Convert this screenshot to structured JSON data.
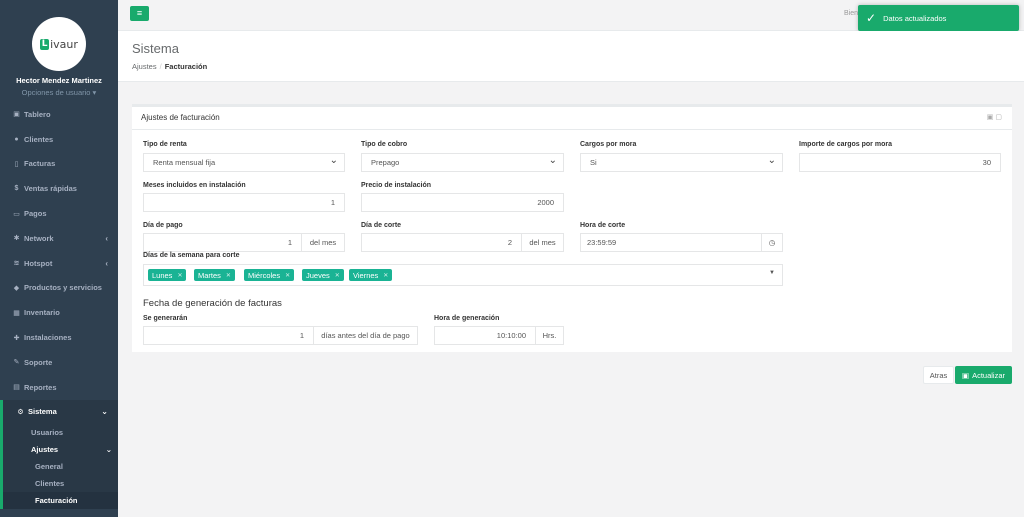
{
  "profile": {
    "logo_text": "ivaur",
    "logo_letter": "L",
    "name": "Hector Mendez Martinez",
    "options": "Opciones de usuario ▾"
  },
  "nav": {
    "tablero": "Tablero",
    "clientes": "Clientes",
    "facturas": "Facturas",
    "ventas": "Ventas rápidas",
    "pagos": "Pagos",
    "network": "Network",
    "hotspot": "Hotspot",
    "productos": "Productos y servicios",
    "inventario": "Inventario",
    "instalaciones": "Instalaciones",
    "soporte": "Soporte",
    "reportes": "Reportes",
    "sistema": "Sistema",
    "usuarios": "Usuarios",
    "ajustes": "Ajustes",
    "general": "General",
    "clientes_sub": "Clientes",
    "facturacion": "Facturación"
  },
  "topbar": {
    "welcome": "Bien"
  },
  "toast": {
    "message": "Datos actualizados"
  },
  "page": {
    "title": "Sistema",
    "breadcrumb": [
      "Ajustes",
      "Facturación"
    ]
  },
  "card": {
    "title": "Ajustes de facturación"
  },
  "form": {
    "tipo_renta": {
      "label": "Tipo de renta",
      "value": "Renta mensual fija"
    },
    "tipo_cobro": {
      "label": "Tipo de cobro",
      "value": "Prepago"
    },
    "cargos_mora": {
      "label": "Cargos por mora",
      "value": "Si"
    },
    "importe_mora": {
      "label": "Importe de cargos por mora",
      "value": "30"
    },
    "meses_instalacion": {
      "label": "Meses incluidos en instalación",
      "value": "1"
    },
    "precio_instalacion": {
      "label": "Precio de instalación",
      "value": "2000"
    },
    "dia_pago": {
      "label": "Día de pago",
      "value": "1",
      "addon": "del mes"
    },
    "dia_corte": {
      "label": "Día de corte",
      "value": "2",
      "addon": "del mes"
    },
    "hora_corte": {
      "label": "Hora de corte",
      "value": "23:59:59"
    },
    "dias_semana": {
      "label": "Días de la semana para corte",
      "tags": [
        "Lunes",
        "Martes",
        "Miércoles",
        "Jueves",
        "Viernes"
      ]
    },
    "section_title": "Fecha de generación de facturas",
    "se_generaran": {
      "label": "Se generarán",
      "value": "1",
      "addon": "días antes del día de pago"
    },
    "hora_generacion": {
      "label": "Hora de generación",
      "value": "10:10:00",
      "addon": "Hrs."
    }
  },
  "actions": {
    "back": "Atras",
    "save": "Actualizar"
  },
  "colors": {
    "sidebar": "#2f4050",
    "accent": "#19aa6c",
    "tag": "#1ab394"
  }
}
